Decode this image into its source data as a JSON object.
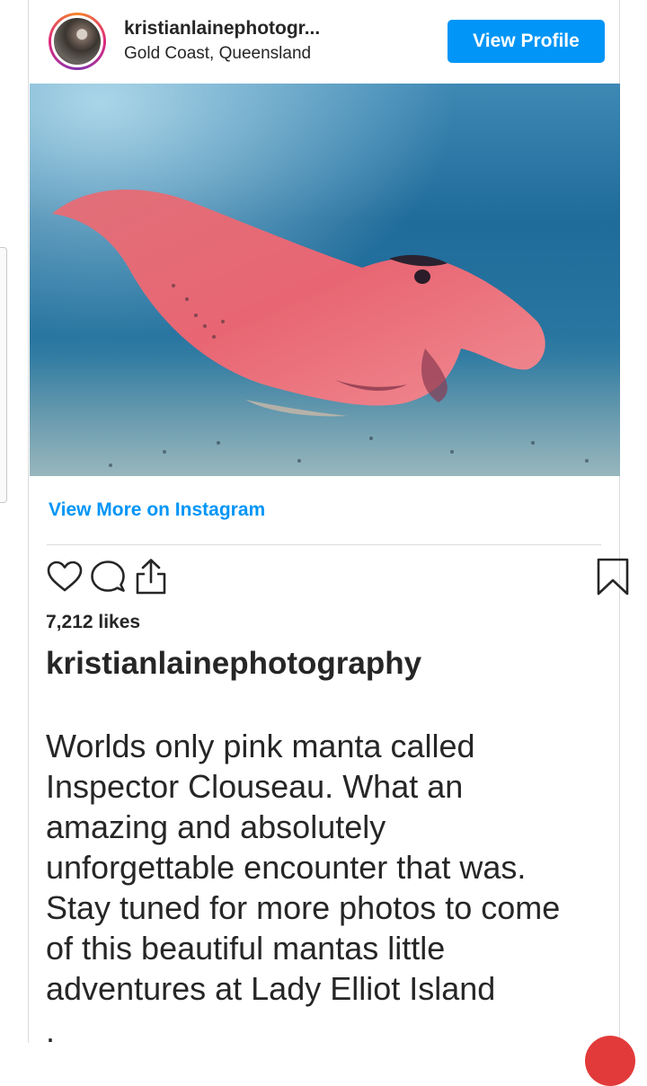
{
  "header": {
    "username": "kristianlainephotogr...",
    "location": "Gold Coast, Queensland",
    "view_profile_label": "View Profile"
  },
  "post": {
    "view_more_label": "View More on Instagram",
    "likes": "7,212 likes",
    "caption_username": "kristianlainephotography",
    "caption_lines": [
      "Worlds only pink manta called",
      "Inspector Clouseau. What an",
      "amazing and absolutely",
      "unforgettable encounter that was.",
      "Stay tuned for more photos to come",
      "of this beautiful mantas little",
      "adventures at Lady Elliot Island"
    ],
    "caption_trailing": "."
  },
  "icons": {
    "like": "heart-icon",
    "comment": "comment-icon",
    "share": "share-icon",
    "save": "bookmark-icon"
  },
  "colors": {
    "accent": "#0095f6",
    "text": "#262626",
    "divider": "#dbdbdb"
  }
}
